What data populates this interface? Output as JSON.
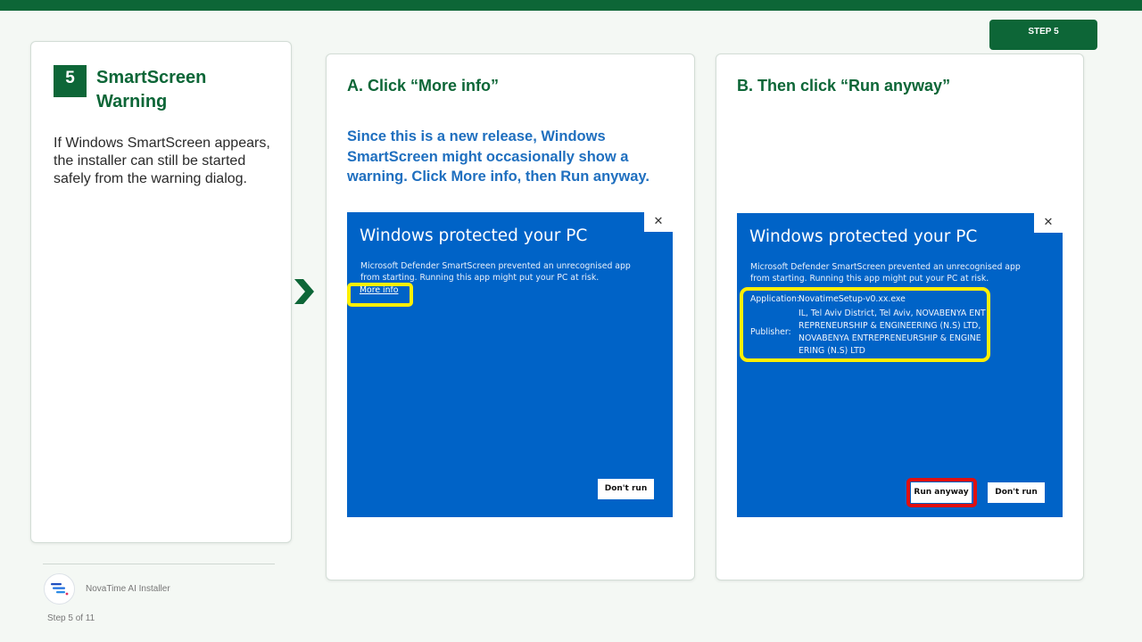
{
  "step_badge": "STEP 5",
  "left": {
    "number": "5",
    "title": "SmartScreen Warning",
    "body": "If Windows SmartScreen appears, the installer can still be started safely from the warning dialog."
  },
  "card_a": {
    "title": "A. Click “More info”",
    "note": "Since this is a new release, Windows SmartScreen might occasionally show a warning. Click More info, then Run anyway.",
    "dialog": {
      "close": "✕",
      "heading": "Windows protected your PC",
      "text": "Microsoft Defender SmartScreen prevented an unrecognised app from starting. Running this app might put your PC at risk.",
      "more_info": "More info",
      "dont_run": "Don't run"
    }
  },
  "card_b": {
    "title": "B. Then click “Run anyway”",
    "dialog": {
      "close": "✕",
      "heading": "Windows protected your PC",
      "text": "Microsoft Defender SmartScreen prevented an unrecognised app from starting. Running this app might put your PC at risk.",
      "application_label": "Application:",
      "application_value": "NovatimeSetup-v0.xx.exe",
      "publisher_label": "Publisher:",
      "publisher_lines": [
        "IL, Tel Aviv District, Tel Aviv, NOVABENYA ENT",
        "REPRENEURSHIP & ENGINEERING (N.S) LTD,",
        "NOVABENYA ENTREPRENEURSHIP & ENGINE",
        "ERING (N.S) LTD"
      ],
      "run_anyway": "Run anyway",
      "dont_run": "Don't run"
    }
  },
  "footer": {
    "app_name": "NovaTime AI Installer",
    "step_counter": "Step 5 of 11"
  },
  "colors": {
    "brand_green": "#0d6637",
    "dialog_blue": "#0063c7",
    "highlight_yellow": "#ffef00",
    "highlight_red": "#e01010",
    "note_blue": "#1f6fbf"
  },
  "icons": {
    "chevron": "chevron-right-icon",
    "logo": "novatime-logo-icon"
  }
}
